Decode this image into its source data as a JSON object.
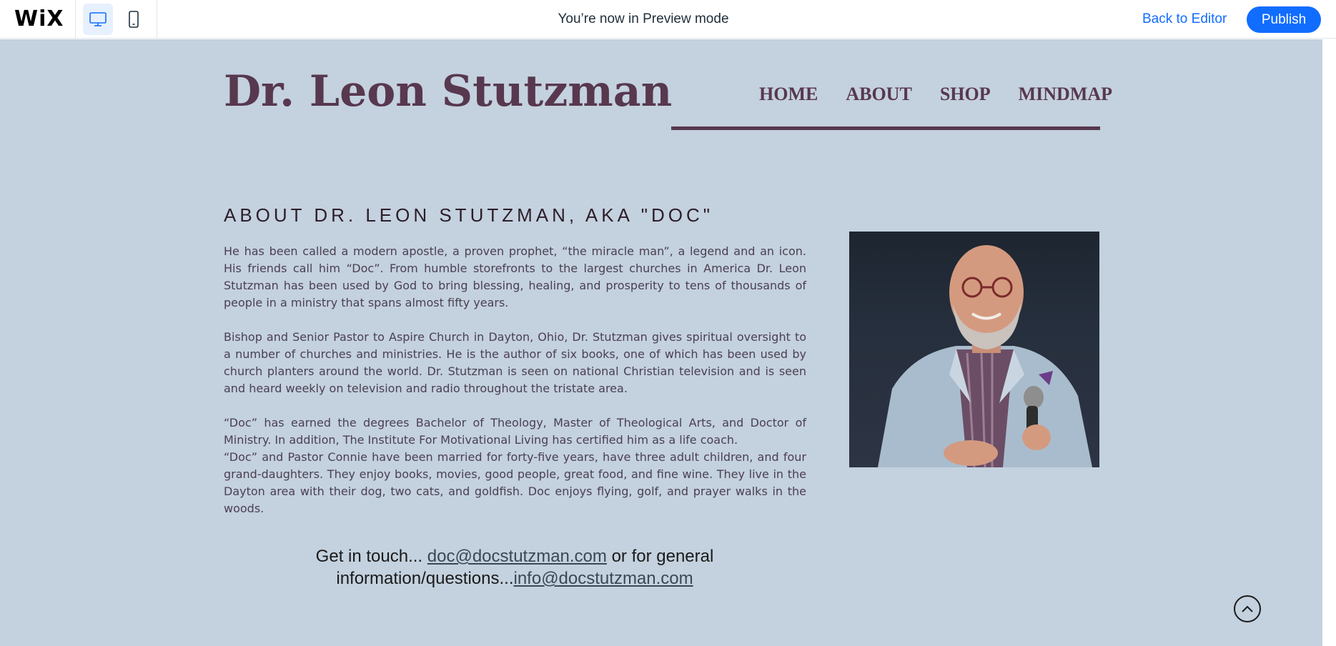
{
  "topbar": {
    "logo": "WiX",
    "preview_text": "You’re now in Preview mode",
    "back_label": "Back to Editor",
    "publish_label": "Publish",
    "accent": "#116dff"
  },
  "site": {
    "title": "Dr. Leon Stutzman",
    "nav": [
      "HOME",
      "ABOUT",
      "SHOP",
      "MINDMAP"
    ],
    "about_heading": "ABOUT DR. LEON STUTZMAN, AKA \"DOC\"",
    "bio": [
      "He has been called a modern apostle, a proven prophet, “the miracle man”, a legend and an icon. His friends call him “Doc”. From humble storefronts to the largest churches in America Dr. Leon Stutzman has been used by God to bring blessing, healing, and prosperity to tens of thousands of people in a ministry that spans almost fifty years.",
      "Bishop and Senior Pastor to Aspire Church in Dayton, Ohio, Dr. Stutzman gives spiritual oversight to a number of churches and ministries. He is the author of six books, one of which has been used by church planters around the world. Dr. Stutzman is seen on national Christian television and is seen and heard weekly on television and radio throughout the tristate area.",
      "“Doc” has earned the degrees Bachelor of Theology, Master of Theological Arts, and Doctor of Ministry. In addition, The Institute For Motivational Living has certified him as a life coach.",
      "“Doc” and Pastor Connie have been married for forty-five years, have three adult children, and four grand-daughters. They enjoy books, movies, good people, great food, and fine wine. They live in the Dayton area with their dog, two cats, and goldfish. Doc enjoys flying, golf, and prayer walks in the woods."
    ],
    "contact": {
      "prefix": "Get in touch... ",
      "email1": "doc@docstutzman.com",
      "middle": " or for general information/questions...",
      "email2": "info@docstutzman.com"
    },
    "colors": {
      "background": "#c4d1de",
      "brand": "#57384f"
    }
  }
}
